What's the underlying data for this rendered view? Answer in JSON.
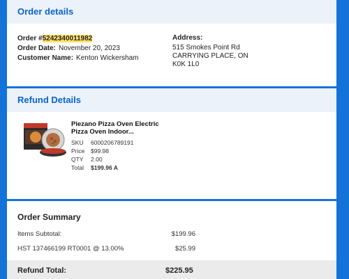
{
  "order_details": {
    "heading": "Order details",
    "order_label": "Order #",
    "order_number": "5242340011982",
    "date_label": "Order Date:",
    "date_value": "November 20, 2023",
    "customer_label": "Customer Name:",
    "customer_value": "Kenton Wickersham",
    "address_label": "Address:",
    "address_line1": "515 Smokes Point Rd",
    "address_line2": "CARRYING PLACE, ON",
    "address_line3": "K0K 1L0"
  },
  "refund_details": {
    "heading": "Refund Details",
    "product": {
      "name_line1": "Piezano Pizza Oven Electric",
      "name_line2": "Pizza Oven Indoor...",
      "image_icon": "pizza-oven-product-image",
      "sku_label": "SKU",
      "sku_value": "6000206789191",
      "price_label": "Price",
      "price_value": "$99.98",
      "qty_label": "QTY",
      "qty_value": "2.00",
      "total_label": "Total",
      "total_value": "$199.96 A"
    }
  },
  "order_summary": {
    "heading": "Order Summary",
    "subtotal_label": "Items Subtotal:",
    "subtotal_value": "$199.96",
    "tax_label": "HST 137466199 RT0001 @ 13.00%",
    "tax_value": "$25.99",
    "refund_total_label": "Refund Total:",
    "refund_total_value": "$225.95"
  },
  "colors": {
    "page_background": "#1473d8",
    "section_header_bg": "#ebf2f9",
    "section_header_text": "#0a63c9",
    "order_highlight": "#ffe066"
  }
}
